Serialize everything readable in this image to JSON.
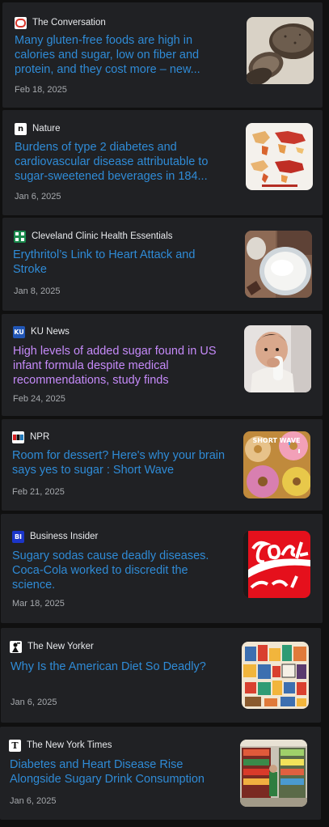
{
  "articles": [
    {
      "source": "The Conversation",
      "logo_icon": "the-conversation-logo-icon",
      "title": "Many gluten-free foods are high in calories and sugar, low on fiber and protein, and they cost more – new...",
      "date": "Feb 18, 2025",
      "thumbnail": "gluten-free-bread-thumbnail",
      "visited": false
    },
    {
      "source": "Nature",
      "logo_icon": "nature-logo-icon",
      "title": "Burdens of type 2 diabetes and cardiovascular disease attributable to sugar-sweetened beverages in 184...",
      "date": "Jan 6, 2025",
      "thumbnail": "world-map-thumbnail",
      "visited": false
    },
    {
      "source": "Cleveland Clinic Health Essentials",
      "logo_icon": "cleveland-clinic-logo-icon",
      "title": "Erythritol’s Link to Heart Attack and Stroke",
      "date": "Jan 8, 2025",
      "thumbnail": "sweetener-bowl-thumbnail",
      "visited": false
    },
    {
      "source": "KU News",
      "logo_icon": "ku-news-logo-icon",
      "title": "High levels of added sugar found in US infant formula despite medical recommendations, study finds",
      "date": "Feb 24, 2025",
      "thumbnail": "infant-bottle-thumbnail",
      "visited": true
    },
    {
      "source": "NPR",
      "logo_icon": "npr-logo-icon",
      "title": "Room for dessert? Here's why your brain says yes to sugar : Short Wave",
      "date": "Feb 21, 2025",
      "thumbnail": "donuts-thumbnail",
      "thumbnail_text": "SHORT WAVE",
      "visited": false
    },
    {
      "source": "Business Insider",
      "logo_icon": "business-insider-logo-icon",
      "title": "Sugary sodas cause deadly diseases. Coca-Cola worked to discredit the science.",
      "date": "Mar 18, 2025",
      "thumbnail": "coca-cola-sign-thumbnail",
      "visited": false
    },
    {
      "source": "The New Yorker",
      "logo_icon": "the-new-yorker-logo-icon",
      "title": "Why Is the American Diet So Deadly?",
      "date": "Jan 6, 2025",
      "thumbnail": "processed-food-illustration-thumbnail",
      "visited": false
    },
    {
      "source": "The New York Times",
      "logo_icon": "new-york-times-logo-icon",
      "title": "Diabetes and Heart Disease Rise Alongside Sugary Drink Consumption",
      "date": "Jan 6, 2025",
      "thumbnail": "drink-aisle-thumbnail",
      "visited": false
    }
  ],
  "colors": {
    "page_background": "#101010",
    "card_background": "#202124",
    "title_link": "#2f8bd6",
    "title_visited": "#c58af9",
    "source_text": "#e8eaed",
    "date_text": "#a6a9ad"
  }
}
